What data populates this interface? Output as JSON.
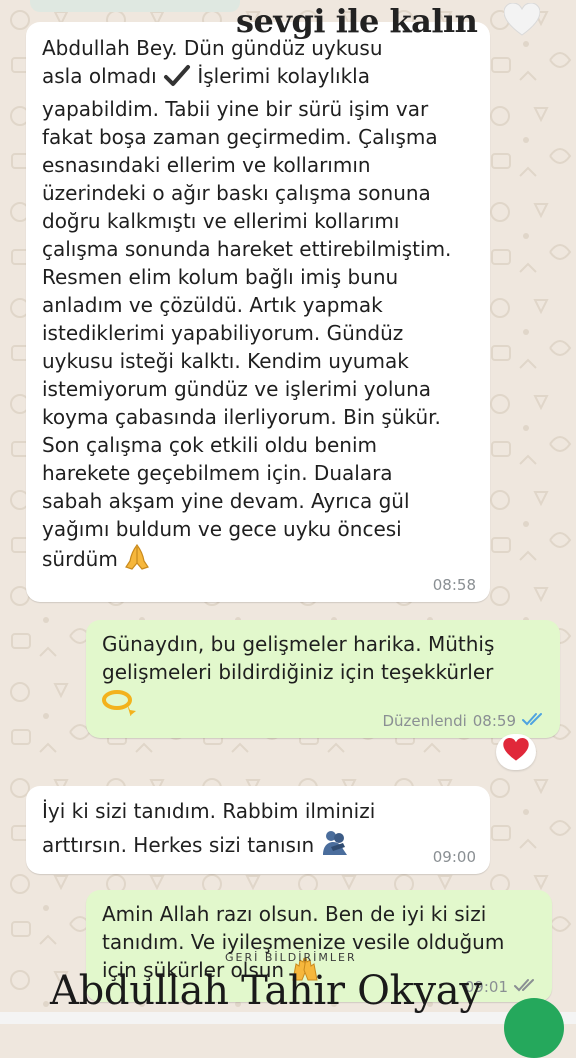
{
  "overlay": {
    "top_caption": "sevgi ile kalın",
    "top_heart_icon": "white-heart-icon",
    "bottom_title": "Abdullah Tahir Okyay",
    "small_caption": "GERİ BİLDİRİMLER"
  },
  "messages": [
    {
      "direction": "incoming",
      "text": "Abdullah Bey. Dün gündüz uykusu\nasla olmadı",
      "emoji1": "check-mark-icon",
      "text2": " İşlerimi kolaylıkla\nyapabildim. Tabii yine bir sürü işim var\nfakat boşa zaman geçirmedim. Çalışma\nesnasındaki ellerim ve kollarımın\nüzerindeki o ağır baskı çalışma sonuna\ndoğru kalkmıştı ve ellerimi kollarımı\nçalışma sonunda hareket ettirebilmiştim.\nResmen elim kolum bağlı imiş bunu\nanladım ve çözüldü. Artık yapmak\nistediklerimi yapabiliyorum. Gündüz\nuykusu isteği kalktı. Kendim uyumak\nistemiyorum gündüz ve işlerimi yoluna\nkoyma çabasında ilerliyorum. Bin şükür.\nSon çalışma çok etkili oldu benim\nharekete geçebilmem için. Dualara\nsabah akşam yine devam. Ayrıca gül\nyağımı buldum ve gece uyku öncesi\nsürdüm",
      "emoji2": "praying-hands-icon",
      "time": "08:58"
    },
    {
      "direction": "outgoing",
      "text": "Günaydın,  bu gelişmeler harika. Müthiş\ngelişmeleri bildirdiğiniz için teşekkürler",
      "emoji": "halo-ring-icon",
      "edited_label": "Düzenlendi",
      "time": "08:59",
      "status_icon": "double-check-read-icon",
      "reaction": "red-heart-icon"
    },
    {
      "direction": "incoming",
      "text": "İyi ki sizi tanıdım. Rabbim ilminizi\narttırsın. Herkes sizi tanısın",
      "emoji": "people-hugging-icon",
      "time": "09:00"
    },
    {
      "direction": "outgoing",
      "text": "Amin Allah razı olsun. Ben de iyi ki sizi\ntanıdım. Ve iyileşmenize vesile olduğum\niçin şükürler olsun",
      "emoji": "raising-hands-icon",
      "time": "09:01",
      "status_icon": "double-check-icon"
    }
  ],
  "colors": {
    "wallpaper": "#efe7de",
    "incoming_bubble": "#ffffff",
    "outgoing_bubble": "#e2f8cc",
    "read_ticks": "#4fa3e0",
    "fab": "#25a85c"
  }
}
